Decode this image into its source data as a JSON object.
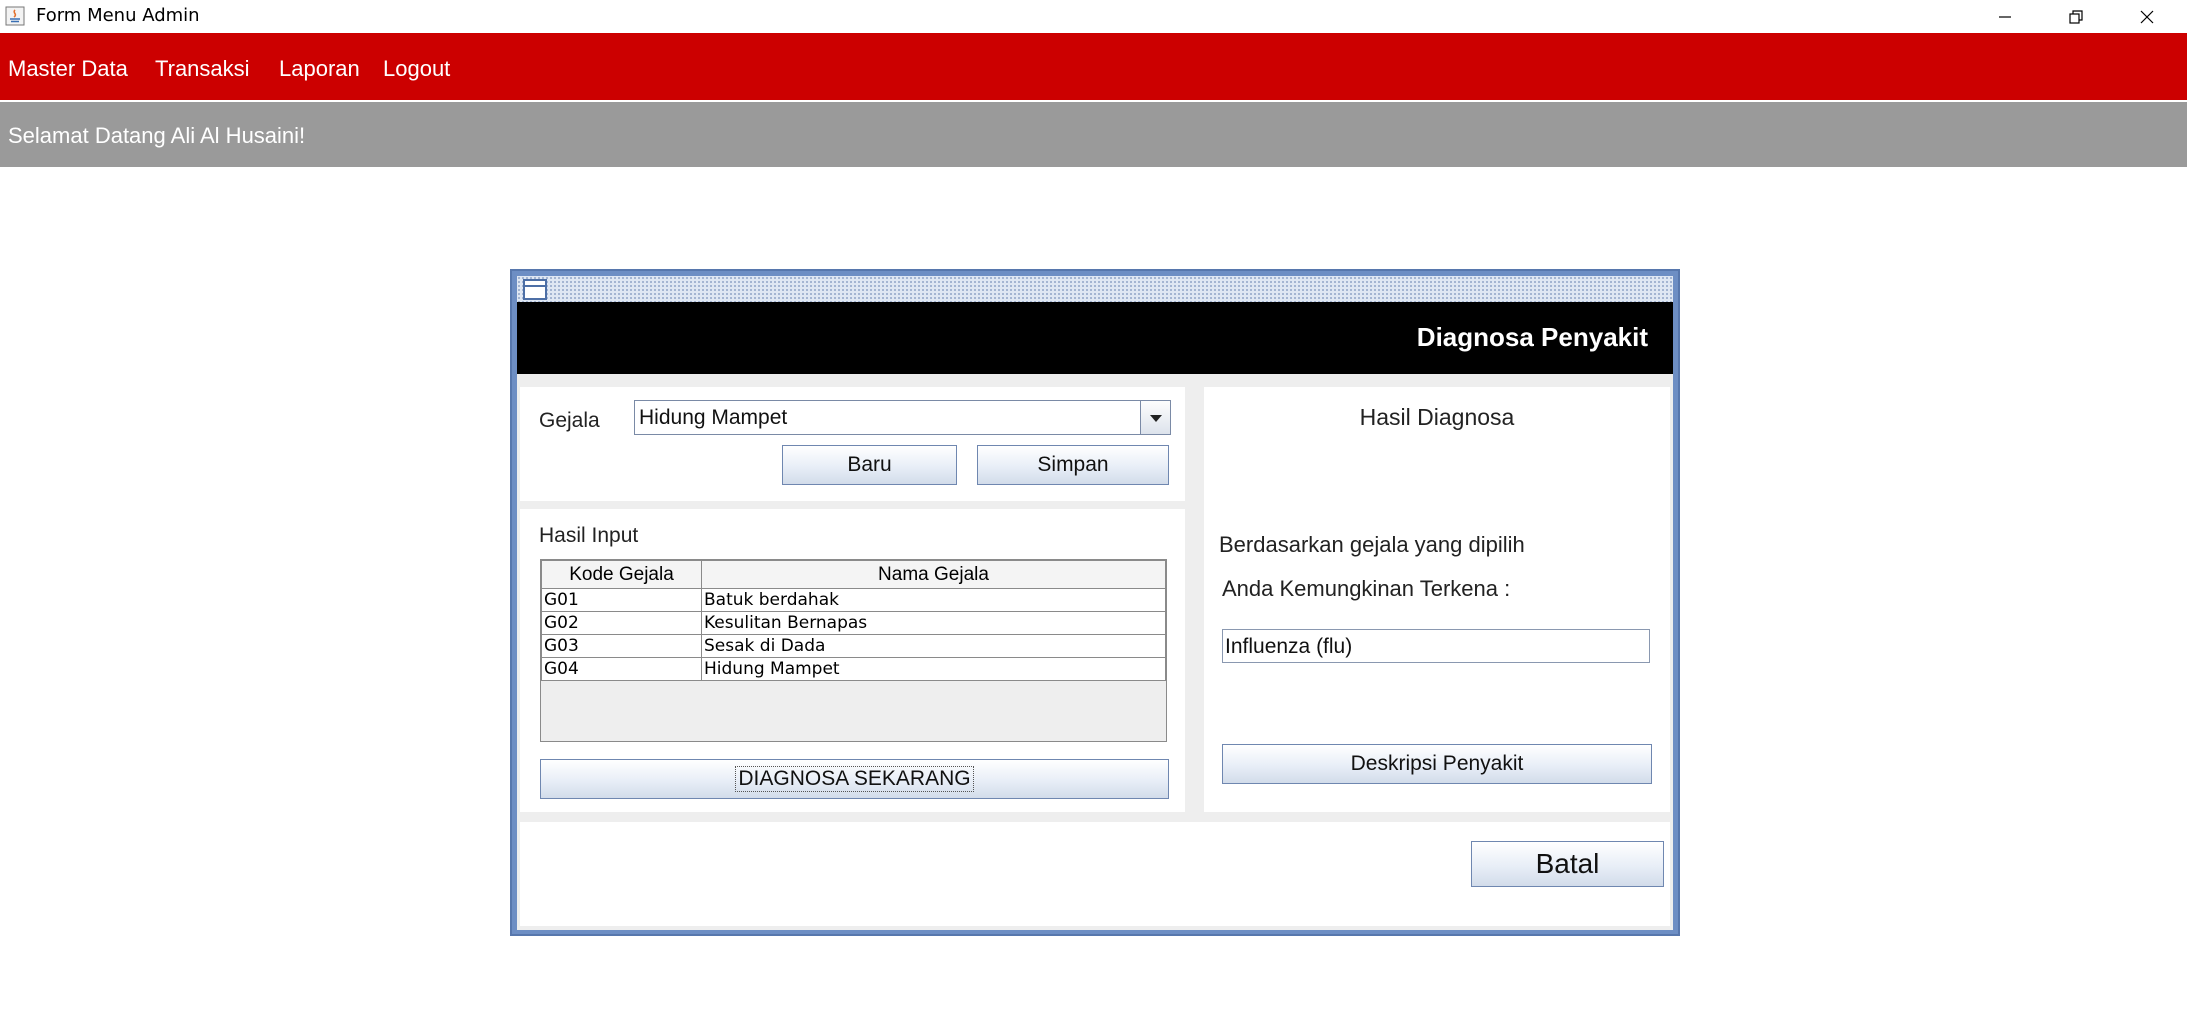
{
  "window": {
    "title": "Form Menu Admin",
    "app_icon": "java-icon"
  },
  "menubar": {
    "items": [
      "Master Data",
      "Transaksi",
      "Laporan",
      "Logout"
    ],
    "bg_color": "#cc0000"
  },
  "welcome": {
    "text": "Selamat Datang Ali Al Husaini!",
    "bg_color": "#9a9a9a"
  },
  "form": {
    "header_title": "Diagnosa Penyakit",
    "gejala": {
      "label": "Gejala",
      "selected": "Hidung Mampet"
    },
    "buttons": {
      "baru": "Baru",
      "simpan": "Simpan",
      "diagnosa": "DIAGNOSA SEKARANG",
      "deskripsi": "Deskripsi Penyakit",
      "batal": "Batal"
    },
    "hasil_input": {
      "label": "Hasil Input",
      "columns": [
        "Kode Gejala",
        "Nama Gejala"
      ],
      "rows": [
        [
          "G01",
          "Batuk berdahak"
        ],
        [
          "G02",
          "Kesulitan Bernapas"
        ],
        [
          "G03",
          "Sesak di Dada"
        ],
        [
          "G04",
          "Hidung Mampet"
        ]
      ]
    },
    "hasil_diagnosa": {
      "title": "Hasil Diagnosa",
      "line1": "Berdasarkan gejala yang dipilih",
      "line2": "Anda Kemungkinan Terkena :",
      "result": "Influenza (flu)"
    }
  }
}
